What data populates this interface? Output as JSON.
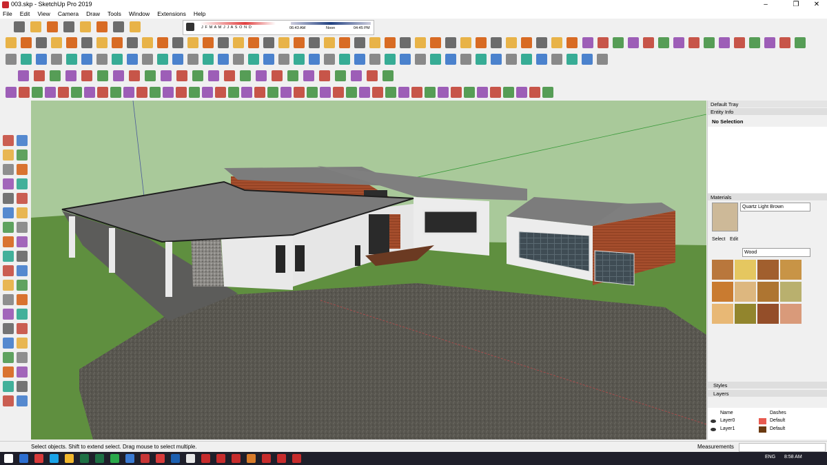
{
  "window": {
    "title": "003.skp - SketchUp Pro 2019",
    "minimize": "–",
    "maximize": "❐",
    "close": "✕"
  },
  "menu": [
    "File",
    "Edit",
    "View",
    "Camera",
    "Draw",
    "Tools",
    "Window",
    "Extensions",
    "Help"
  ],
  "shadows": {
    "months": "J F M A M J J A S O N D",
    "time_start": "06:43 AM",
    "time_mid": "Noon",
    "time_end": "04:45 PM"
  },
  "tray": {
    "title": "Default Tray",
    "entity_info": {
      "header": "Entity Info",
      "value": "No Selection"
    },
    "materials": {
      "header": "Materials",
      "current_name": "Quartz Light Brown",
      "tab_select": "Select",
      "tab_edit": "Edit",
      "library": "Wood",
      "swatches": [
        "#b9773c",
        "#e5c760",
        "#a15f2e",
        "#c89446",
        "#c97b30",
        "#ddb77f",
        "#ae7531",
        "#b9b06e",
        "#e8b875",
        "#92852d",
        "#944e29",
        "#d99a7a"
      ]
    },
    "styles": {
      "header": "Styles"
    },
    "layers": {
      "header": "Layers",
      "col_name": "Name",
      "col_dashes": "Dashes",
      "rows": [
        {
          "name": "Layer0",
          "color": "#e85a4f",
          "dashes": "Default"
        },
        {
          "name": "Layer1",
          "color": "#6b3a10",
          "dashes": "Default"
        }
      ]
    }
  },
  "status": {
    "message": "Select objects. Shift to extend select. Drag mouse to select multiple.",
    "measurements_label": "Measurements"
  },
  "taskbar": {
    "lang": "ENG",
    "time": "8:58 AM"
  },
  "colors": {
    "sky": "#a7c996",
    "grass": "#5e8e3e",
    "gravel": "#55534f",
    "roof": "#7a7a7a",
    "wall": "#e6e6e6",
    "wood": "#a14a2c"
  }
}
